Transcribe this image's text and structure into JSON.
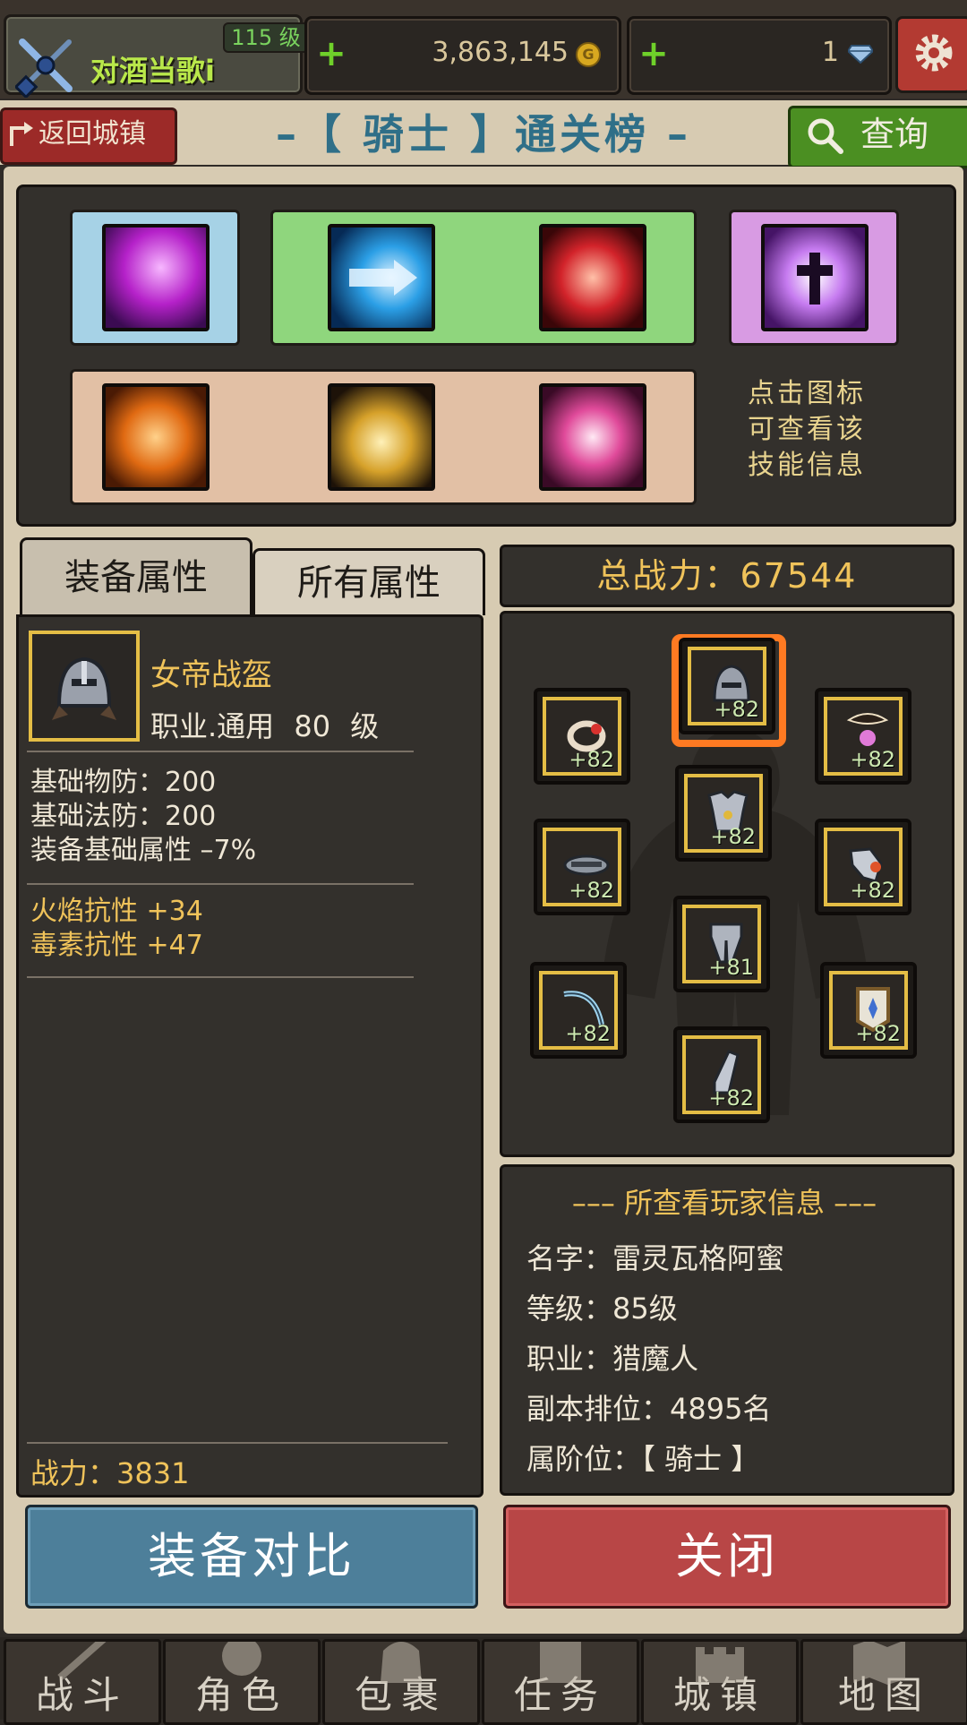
{
  "header": {
    "player_name": "对酒当歌i",
    "player_level": "115 级",
    "gold": "3,863,145",
    "gold_icon": "coin-icon",
    "gems": "1",
    "gem_icon": "diamond-icon",
    "add_symbol": "+",
    "settings_icon": "gear-icon"
  },
  "title_bar": {
    "back_label": "返回城镇",
    "title": "–【 骑士 】通关榜 –",
    "query_label": "查询"
  },
  "skills": {
    "hint_lines": [
      "点击图标",
      "可查看该",
      "技能信息"
    ],
    "row1_icons": [
      "purple-slash-skill-icon",
      "blue-arrow-skill-icon",
      "red-dragon-skill-icon",
      "holy-cross-skill-icon"
    ],
    "row2_icons": [
      "chain-skill-icon",
      "golden-armor-skill-icon",
      "shield-burst-skill-icon"
    ],
    "colors": {
      "blue_group": "#a6d2e6",
      "green_group": "#8fd67d",
      "purple_group": "#d89be3",
      "tan_group": "#e2c0a5"
    }
  },
  "tabs": {
    "equip_attr": "装备属性",
    "all_attr": "所有属性"
  },
  "item": {
    "name": "女帝战盔",
    "sub": "职业.通用   80 级",
    "base_stats": [
      "基础物防：200",
      "基础法防：200",
      "装备基础属性 –7%"
    ],
    "bonus_stats": [
      "火焰抗性 +34",
      "毒素抗性 +47"
    ],
    "power": "战力：3831"
  },
  "total_power": "总战力：67544",
  "gear": [
    {
      "name": "helmet",
      "level": "+82",
      "selected": true
    },
    {
      "name": "ring",
      "level": "+82"
    },
    {
      "name": "necklace",
      "level": "+82"
    },
    {
      "name": "armor",
      "level": "+82"
    },
    {
      "name": "belt",
      "level": "+82"
    },
    {
      "name": "gauntlet",
      "level": "+82"
    },
    {
      "name": "legs",
      "level": "+81"
    },
    {
      "name": "bow",
      "level": "+82"
    },
    {
      "name": "shield",
      "level": "+82"
    },
    {
      "name": "boots",
      "level": "+82"
    }
  ],
  "player_info": {
    "title": "––– 所查看玩家信息 –––",
    "name": "名字：雷灵瓦格阿蜜",
    "level": "等级：85级",
    "class": "职业：猎魔人",
    "rank": "副本排位：4895名",
    "tier": "属阶位：【 骑士 】"
  },
  "buttons": {
    "compare": "装备对比",
    "close": "关闭"
  },
  "nav": [
    "战斗",
    "角色",
    "包裹",
    "任务",
    "城镇",
    "地图"
  ]
}
